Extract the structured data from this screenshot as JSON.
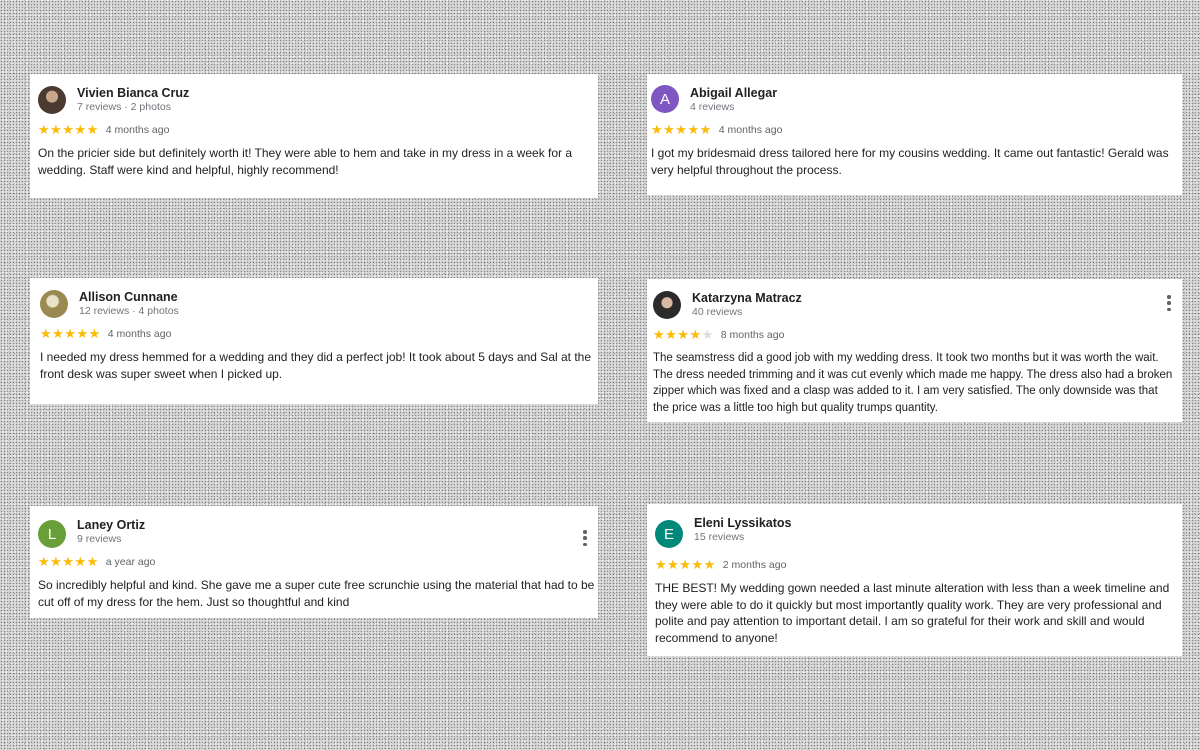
{
  "reviews": [
    {
      "name": "Vivien Bianca Cruz",
      "meta": "7 reviews · 2 photos",
      "avatar": {
        "type": "photo",
        "letter": "",
        "color": ""
      },
      "rating": 5,
      "stars": "★★★★★",
      "time": "4 months ago",
      "text": "On the pricier side but definitely worth it! They were able to hem and take in my dress in a week for a wedding. Staff were kind and helpful, highly recommend!",
      "has_menu": false
    },
    {
      "name": "Abigail Allegar",
      "meta": "4 reviews",
      "avatar": {
        "type": "letter",
        "letter": "A",
        "color": "#7e57c2"
      },
      "rating": 5,
      "stars": "★★★★★",
      "time": "4 months ago",
      "text": "I got my bridesmaid dress tailored here for my cousins wedding. It came out fantastic! Gerald was very helpful throughout the process.",
      "has_menu": false
    },
    {
      "name": "Allison Cunnane",
      "meta": "12 reviews · 4 photos",
      "avatar": {
        "type": "photo",
        "letter": "",
        "color": ""
      },
      "rating": 5,
      "stars": "★★★★★",
      "time": "4 months ago",
      "text": "I needed my dress hemmed for a wedding and they did a perfect job! It took about 5 days and Sal at the front desk was super sweet when I picked up.",
      "has_menu": false
    },
    {
      "name": "Katarzyna Matracz",
      "meta": "40 reviews",
      "avatar": {
        "type": "photo",
        "letter": "",
        "color": ""
      },
      "rating": 4,
      "stars": "★★★★★",
      "time": "8 months ago",
      "text": "The seamstress did a good job with my wedding dress. It took two months but it was worth the wait. The dress needed trimming and it was cut evenly which made me happy. The dress also had a broken zipper which was fixed and a clasp was added to it. I am very satisfied. The only downside was that the price was a little too high but quality trumps quantity.",
      "has_menu": true
    },
    {
      "name": "Laney Ortiz",
      "meta": "9 reviews",
      "avatar": {
        "type": "letter",
        "letter": "L",
        "color": "#689f38"
      },
      "rating": 5,
      "stars": "★★★★★",
      "time": "a year ago",
      "text": "So incredibly helpful and kind. She gave me a super cute free scrunchie using the material that had to be cut off of my dress for the hem. Just so thoughtful and kind",
      "has_menu": true
    },
    {
      "name": "Eleni Lyssikatos",
      "meta": "15 reviews",
      "avatar": {
        "type": "letter",
        "letter": "E",
        "color": "#00897b"
      },
      "rating": 5,
      "stars": "★★★★★",
      "time": "2 months ago",
      "text": "THE BEST! My wedding gown needed a last minute alteration with less than a week timeline and they were able to do it quickly but most importantly quality work. They are very professional and polite and pay attention to important detail. I am so grateful for their work and skill and would recommend to anyone!",
      "has_menu": false
    }
  ],
  "colors": {
    "star": "#fbbc04",
    "star_empty": "#dadce0",
    "menu_icon": "#5f6368"
  }
}
